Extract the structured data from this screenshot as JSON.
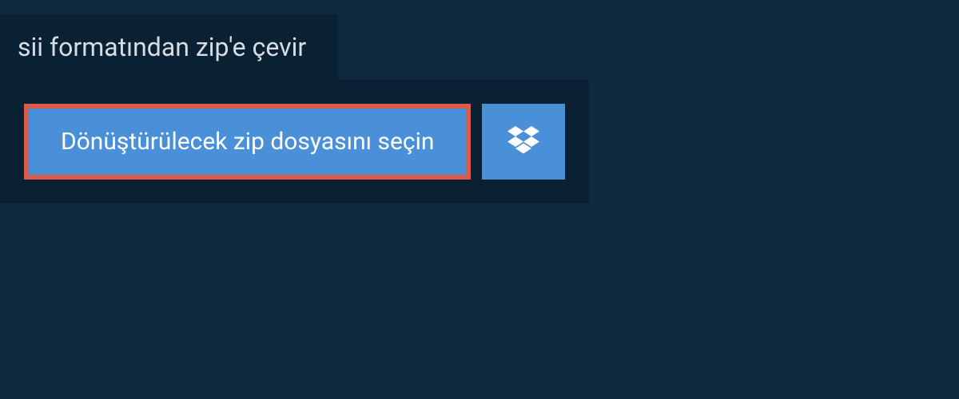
{
  "header": {
    "title": "sii formatından zip'e çevir"
  },
  "actions": {
    "select_file_label": "Dönüştürülecek zip dosyasını seçin",
    "dropbox_icon": "dropbox-icon"
  },
  "colors": {
    "page_bg": "#0f2940",
    "panel_bg": "#0a2033",
    "button_bg": "#4a90d9",
    "button_border": "#db5a4a",
    "text_light": "#d7dde3",
    "text_white": "#ffffff"
  }
}
